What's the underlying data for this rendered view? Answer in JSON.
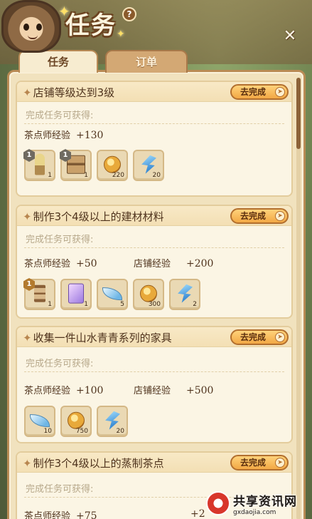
{
  "header": {
    "title": "任务",
    "help_icon": "?",
    "close_icon": "✕"
  },
  "tabs": [
    {
      "label": "任务",
      "active": true
    },
    {
      "label": "订单",
      "active": false
    }
  ],
  "reward_prefix": "完成任务可获得:",
  "go_button_label": "去完成",
  "tasks": [
    {
      "title": "店铺等级达到3级",
      "exp": [
        {
          "label": "茶点师经验",
          "value": "+130"
        }
      ],
      "items": [
        {
          "icon": "plant-furniture-icon",
          "level": "1",
          "qty": "1"
        },
        {
          "icon": "chair-furniture-icon",
          "level": "1",
          "qty": "1"
        },
        {
          "icon": "coin-icon",
          "qty": "220"
        },
        {
          "icon": "gem-icon",
          "qty": "20"
        }
      ]
    },
    {
      "title": "制作3个4级以上的建材材料",
      "exp": [
        {
          "label": "茶点师经验",
          "value": "+50"
        },
        {
          "label": "店铺经验",
          "value": "+200"
        }
      ],
      "items": [
        {
          "icon": "hourglass-icon",
          "level": "1",
          "qty": "1"
        },
        {
          "icon": "ticket-icon",
          "qty": "1"
        },
        {
          "icon": "leaf-icon",
          "qty": "5"
        },
        {
          "icon": "coin-icon",
          "qty": "300"
        },
        {
          "icon": "gem-icon",
          "qty": "2"
        }
      ]
    },
    {
      "title": "收集一件山水青青系列的家具",
      "exp": [
        {
          "label": "茶点师经验",
          "value": "+100"
        },
        {
          "label": "店铺经验",
          "value": "+500"
        }
      ],
      "items": [
        {
          "icon": "leaf-icon",
          "qty": "10"
        },
        {
          "icon": "coin-icon",
          "qty": "750"
        },
        {
          "icon": "gem-icon",
          "qty": "20"
        }
      ]
    },
    {
      "title": "制作3个4级以上的蒸制茶点",
      "exp": [
        {
          "label": "茶点师经验",
          "value": "+75"
        },
        {
          "label": "",
          "value": "+2"
        }
      ],
      "items": []
    }
  ],
  "watermark": {
    "name": "共享资讯网",
    "url": "gxdaojia.com"
  }
}
